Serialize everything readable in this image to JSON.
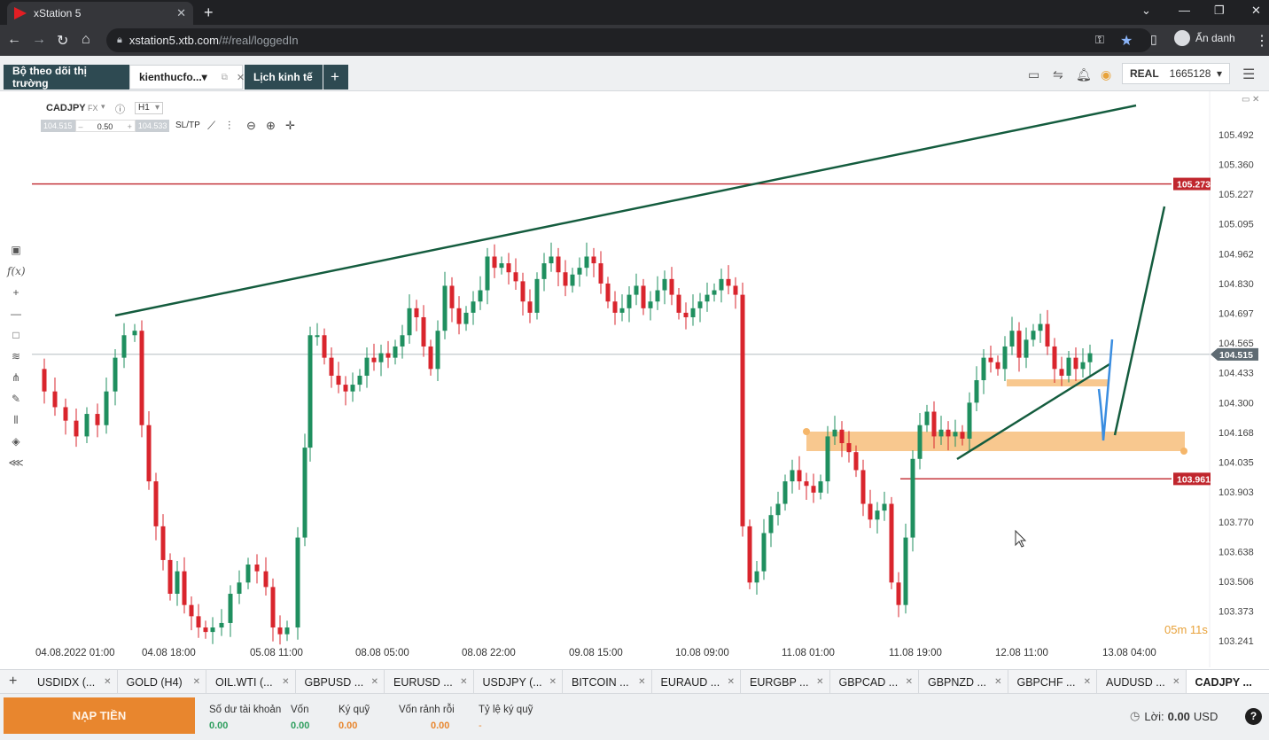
{
  "browser": {
    "tab_title": "xStation 5",
    "tab_close": "✕",
    "new_tab": "+",
    "url_host": "xstation5.xtb.com",
    "url_path": "/#/real/loggedIn",
    "profile_name": "Ẩn danh"
  },
  "header": {
    "tabs": [
      {
        "label": "Bộ theo dõi thị trường"
      },
      {
        "label": "kienthucfo...▾"
      },
      {
        "label": "Lịch kinh tế"
      },
      {
        "label": "+"
      }
    ],
    "account_type": "REAL",
    "account_number": "1665128",
    "account_caret": "▾"
  },
  "chart_panel": {
    "symbol": "CADJPY",
    "market": "FX",
    "timeframe": "H1",
    "bid": "104.515",
    "minus": "–",
    "volume": "0.50",
    "plus": "+",
    "ask": "104.533",
    "sltp": "SL/TP",
    "timer": "05m 11s"
  },
  "chart_data": {
    "type": "candlestick",
    "y_ticks": [
      "105.492",
      "105.360",
      "105.227",
      "105.095",
      "104.962",
      "104.830",
      "104.697",
      "104.565",
      "104.433",
      "104.300",
      "104.168",
      "104.035",
      "103.903",
      "103.770",
      "103.638",
      "103.506",
      "103.373",
      "103.241"
    ],
    "x_ticks": [
      "04.08.2022 01:00",
      "04.08 18:00",
      "05.08 11:00",
      "08.08 05:00",
      "08.08 22:00",
      "09.08 15:00",
      "10.08 09:00",
      "11.08 01:00",
      "11.08 19:00",
      "12.08 11:00",
      "13.08 04:00"
    ],
    "ylim": [
      103.241,
      105.492
    ],
    "price_labels": [
      {
        "value": "105.273",
        "color": "#c0262d"
      },
      {
        "value": "103.961",
        "color": "#c0262d"
      },
      {
        "value": "104.515",
        "color": "#5f6b73"
      }
    ],
    "up_color": "#1f8f5f",
    "down_color": "#d9252d",
    "trendline_color": "#145c3e",
    "zone_color": "#f5b66a",
    "grid": false
  },
  "instruments": {
    "add": "+",
    "close_glyph": "✕",
    "items": [
      {
        "label": "USDIDX (..."
      },
      {
        "label": "GOLD (H4)"
      },
      {
        "label": "OIL.WTI (..."
      },
      {
        "label": "GBPUSD ..."
      },
      {
        "label": "EURUSD ..."
      },
      {
        "label": "USDJPY (..."
      },
      {
        "label": "BITCOIN ..."
      },
      {
        "label": "EURAUD ..."
      },
      {
        "label": "EURGBP ..."
      },
      {
        "label": "GBPCAD ..."
      },
      {
        "label": "GBPNZD ..."
      },
      {
        "label": "GBPCHF ..."
      },
      {
        "label": "AUDUSD ..."
      },
      {
        "label": "CADJPY ..."
      }
    ]
  },
  "account_bar": {
    "deposit_label": "NẠP TIỀN",
    "stats": [
      {
        "label": "Số dư tài khoản",
        "value": "0.00"
      },
      {
        "label": "Vốn",
        "value": "0.00"
      },
      {
        "label": "Ký quỹ",
        "value": "0.00"
      },
      {
        "label": "Vốn rảnh rỗi",
        "value": "0.00"
      },
      {
        "label": "Tỷ lệ ký quỹ",
        "value": "-"
      }
    ],
    "profit_label": "Lời:",
    "profit_value": "0.00",
    "profit_currency": "USD",
    "help": "?"
  }
}
